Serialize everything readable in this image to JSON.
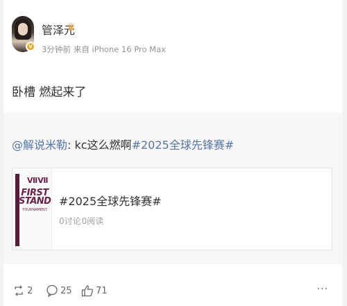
{
  "post": {
    "username": "管泽元",
    "time": "3分钟前",
    "source": "来自 iPhone 16 Pro Max",
    "text": "卧槽 燃起来了",
    "verified_badge": "V"
  },
  "repost": {
    "mention": "@解说米勒",
    "text": ": kc这么燃啊",
    "hashtag": "#2025全球先锋赛#",
    "card": {
      "title": "#2025全球先锋赛#",
      "discussions": "0讨论",
      "reads": "0阅读",
      "thumbnail_text": "FIRST STAND",
      "thumbnail_subtext": "TOURNAMENT",
      "thumbnail_mark": "ⅦⅦ"
    }
  },
  "actions": {
    "repost_count": "2",
    "comment_count": "25",
    "like_count": "71",
    "more_label": "···"
  },
  "colors": {
    "link": "#5576a6",
    "badge": "#f5a623",
    "thumb_brand": "#6a2146"
  }
}
